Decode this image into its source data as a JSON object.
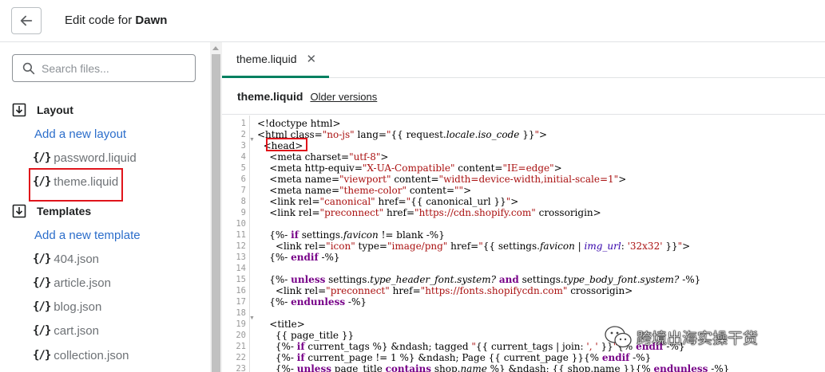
{
  "header": {
    "title_prefix": "Edit code for",
    "theme_name": "Dawn"
  },
  "sidebar": {
    "search_placeholder": "Search files...",
    "layout_label": "Layout",
    "add_layout": "Add a new layout",
    "layout_files": [
      "password.liquid",
      "theme.liquid"
    ],
    "templates_label": "Templates",
    "add_template": "Add a new template",
    "template_files": [
      "404.json",
      "article.json",
      "blog.json",
      "cart.json",
      "collection.json"
    ],
    "file_icon": "{/}"
  },
  "editor": {
    "tab_label": "theme.liquid",
    "tab_close": "✕",
    "file_name": "theme.liquid",
    "older_versions": "Older versions",
    "line_numbers": [
      "1",
      "2",
      "3",
      "4",
      "5",
      "6",
      "7",
      "8",
      "9",
      "10",
      "11",
      "12",
      "13",
      "14",
      "15",
      "16",
      "17",
      "18",
      "19",
      "20",
      "21",
      "22",
      "23"
    ]
  },
  "watermark": {
    "text": "跨境出海实操干货"
  },
  "colors": {
    "accent_green": "#008060",
    "link_blue": "#2c6ecb",
    "highlight_red": "#e0141b",
    "string_red": "#aa1111",
    "keyword_purple": "#770088"
  }
}
